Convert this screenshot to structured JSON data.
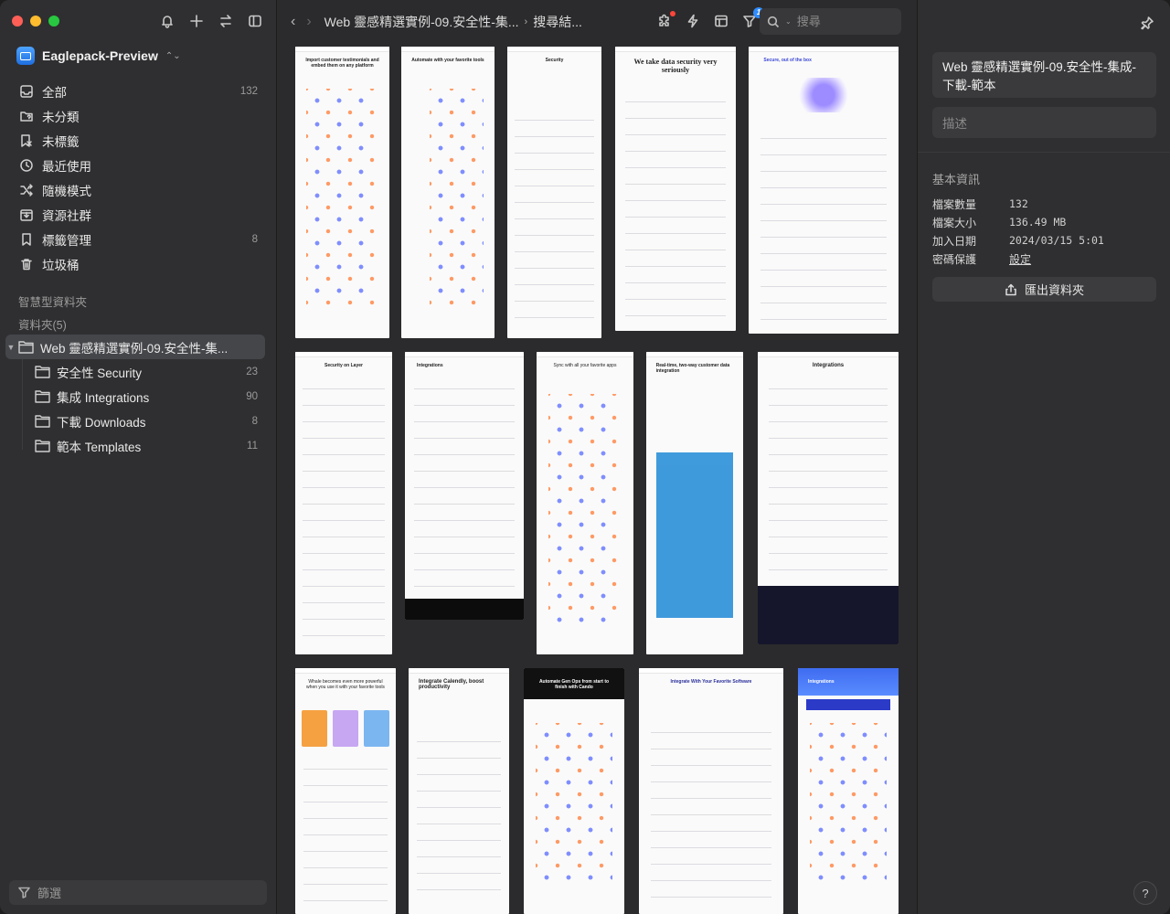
{
  "sidebar": {
    "library_name": "Eaglepack-Preview",
    "nav": [
      {
        "label": "全部",
        "count": "132",
        "icon": "inbox-icon"
      },
      {
        "label": "未分類",
        "count": "",
        "icon": "folder-question-icon"
      },
      {
        "label": "未標籤",
        "count": "",
        "icon": "tag-off-icon"
      },
      {
        "label": "最近使用",
        "count": "",
        "icon": "clock-icon"
      },
      {
        "label": "隨機模式",
        "count": "",
        "icon": "shuffle-icon"
      },
      {
        "label": "資源社群",
        "count": "",
        "icon": "download-tray-icon"
      },
      {
        "label": "標籤管理",
        "count": "8",
        "icon": "bookmark-icon"
      },
      {
        "label": "垃圾桶",
        "count": "",
        "icon": "trash-icon"
      }
    ],
    "smart_folders_title": "智慧型資料夾",
    "folders_title": "資料夾(5)",
    "tree": {
      "root": {
        "label": "Web 靈感精選實例-09.安全性-集...",
        "count": ""
      },
      "children": [
        {
          "label": "安全性 Security",
          "count": "23"
        },
        {
          "label": "集成 Integrations",
          "count": "90"
        },
        {
          "label": "下載 Downloads",
          "count": "8"
        },
        {
          "label": "範本 Templates",
          "count": "11"
        }
      ]
    },
    "filter_placeholder": "篩選"
  },
  "toolbar": {
    "breadcrumb_folder": "Web 靈感精選實例-09.安全性-集...",
    "breadcrumb_search": "搜尋結...",
    "filter_badge": "1",
    "search_placeholder": "搜尋"
  },
  "grid": {
    "thumbs": [
      {
        "title": "Import customer testimonials and embed them on any platform"
      },
      {
        "title": "Automate with your favorite tools"
      },
      {
        "title": "Security"
      },
      {
        "title": "We take data security very seriously"
      },
      {
        "title": "Secure, out of the box"
      },
      {
        "title": "Security on Layer"
      },
      {
        "title": "Integrations"
      },
      {
        "title": "Sync with all your favorite apps"
      },
      {
        "title": "Real-time, two-way customer data integration"
      },
      {
        "title": "Integrations"
      },
      {
        "title": "Whale becomes even more powerful when you use it with your favorite tools"
      },
      {
        "title": "Integrate Calendly, boost productivity"
      },
      {
        "title": "Automate Gen Ops from start to finish with Cando"
      },
      {
        "title": "Integrate With Your Favorite Software"
      },
      {
        "title": "Integrations"
      }
    ]
  },
  "inspector": {
    "name": "Web 靈感精選實例-09.安全性-集成-下載-範本",
    "description_placeholder": "描述",
    "info_title": "基本資訊",
    "rows": [
      {
        "key": "檔案數量",
        "value": "132"
      },
      {
        "key": "檔案大小",
        "value": "136.49 MB"
      },
      {
        "key": "加入日期",
        "value": "2024/03/15 5:01"
      },
      {
        "key": "密碼保護",
        "value": "設定"
      }
    ],
    "export_label": "匯出資料夾",
    "help_label": "?"
  }
}
